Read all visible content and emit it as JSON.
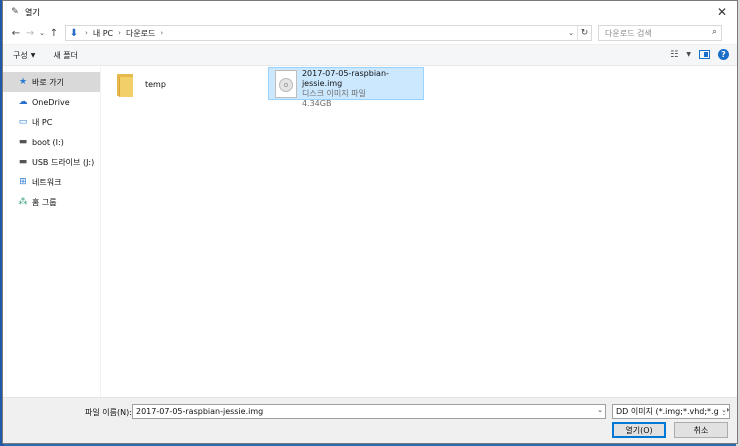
{
  "window": {
    "title": "열기",
    "close_glyph": "✕"
  },
  "address_bar": {
    "breadcrumbs": [
      "내 PC",
      "다운로드"
    ],
    "search_placeholder": "다운로드 검색"
  },
  "command_bar": {
    "organize": "구성",
    "new_folder": "새 폴더"
  },
  "sidebar": {
    "items": [
      {
        "label": "바로 가기",
        "icon": "star-icon",
        "selected": true
      },
      {
        "label": "OneDrive",
        "icon": "onedrive-icon",
        "selected": false
      },
      {
        "label": "내 PC",
        "icon": "pc-icon",
        "selected": false
      },
      {
        "label": "boot (I:)",
        "icon": "drive-icon",
        "selected": false
      },
      {
        "label": "USB 드라이브 (J:)",
        "icon": "usb-drive-icon",
        "selected": false
      },
      {
        "label": "네트워크",
        "icon": "network-icon",
        "selected": false
      },
      {
        "label": "홈 그룹",
        "icon": "homegroup-icon",
        "selected": false
      }
    ]
  },
  "files": {
    "folder": {
      "name": "temp"
    },
    "image_file": {
      "name": "2017-07-05-raspbian-jessie.img",
      "type": "디스크 이미지 파일",
      "size": "4.34GB"
    }
  },
  "bottom": {
    "filename_label": "파일 이름(N):",
    "filename_value": "2017-07-05-raspbian-jessie.img",
    "filter_value": "DD 이미지 (*.img;*.vhd;*.gz;*.i",
    "open_button": "열기(O)",
    "cancel_button": "취소"
  },
  "colors": {
    "selection_bg": "#cce8ff",
    "selection_border": "#99d1ff",
    "accent": "#0078d7"
  }
}
